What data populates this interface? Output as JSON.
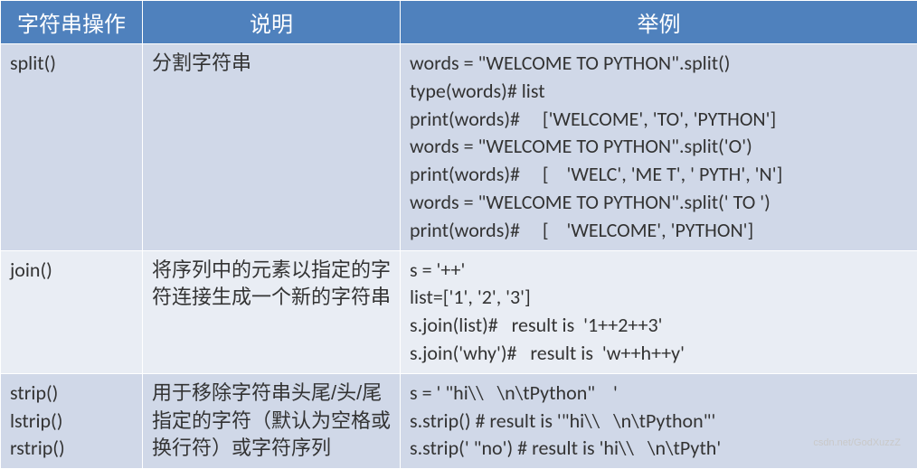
{
  "headers": {
    "col1": "字符串操作",
    "col2": "说明",
    "col3": "举例"
  },
  "rows": [
    {
      "op": "split()",
      "desc": "分割字符串",
      "ex": "words = \"WELCOME TO PYTHON\".split()\ntype(words)# list\nprint(words)#     ['WELCOME', 'TO', 'PYTHON']\nwords = \"WELCOME TO PYTHON\".split('O')\nprint(words)#     [    'WELC', 'ME T', ' PYTH', 'N']\nwords = \"WELCOME TO PYTHON\".split(' TO ')\nprint(words)#     [    'WELCOME', 'PYTHON']"
    },
    {
      "op": "join()",
      "desc": "将序列中的元素以指定的字符连接生成一个新的字符串",
      "ex": "s = '++'\nlist=['1', '2', '3']\ns.join(list)#   result is  '1++2++3'\ns.join('why')#   result is  'w++h++y'"
    },
    {
      "op": "strip()\nlstrip()\nrstrip()",
      "desc": "用于移除字符串头尾/头/尾指定的字符（默认为空格或换行符）或字符序列",
      "ex": "s = ' \"hi\\\\   \\n\\tPython\"    '\ns.strip() # result is '\"hi\\\\   \\n\\tPython\"'\ns.strip(' \"no') # result is 'hi\\\\   \\n\\tPyth'"
    }
  ],
  "watermark": "csdn.net/GodXuzzZ"
}
